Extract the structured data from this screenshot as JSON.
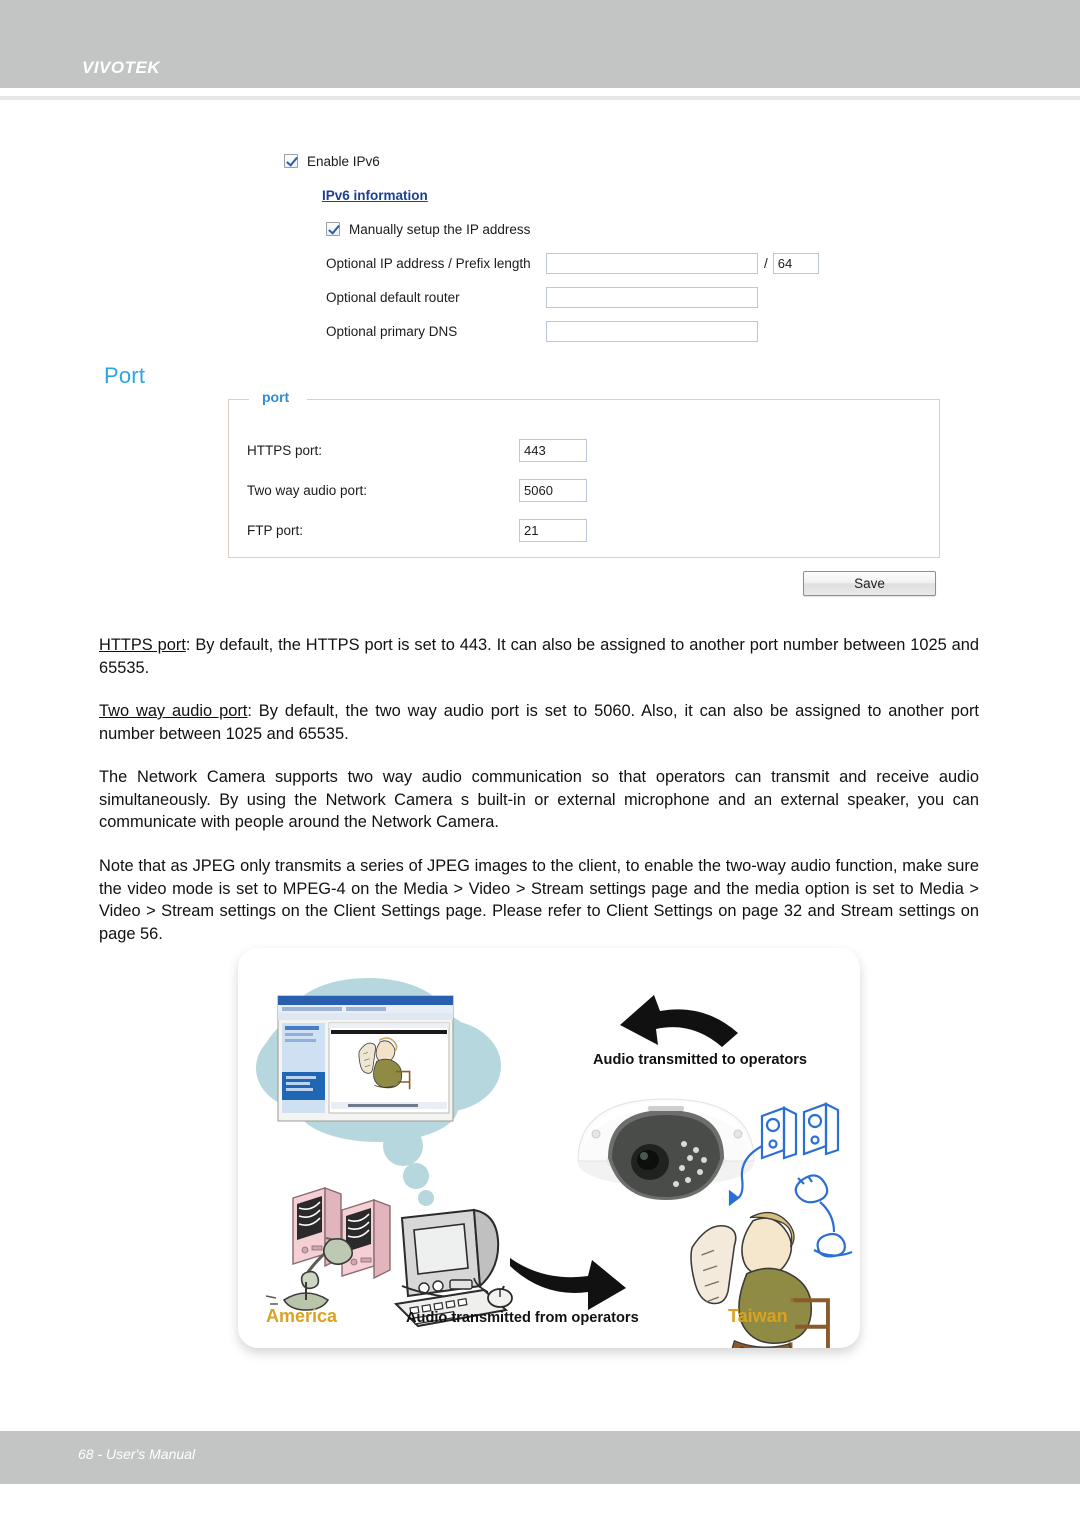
{
  "header": {
    "brand": "VIVOTEK"
  },
  "ipv6": {
    "enable_label": "Enable IPv6",
    "enable_checked": true,
    "info_link": "IPv6 information",
    "manual_label": "Manually setup the IP address",
    "manual_checked": true,
    "fields": [
      {
        "label": "Optional IP address / Prefix length",
        "value": "",
        "has_prefix": true,
        "prefix_value": "64",
        "separator": "/"
      },
      {
        "label": "Optional default router",
        "value": ""
      },
      {
        "label": "Optional primary DNS",
        "value": ""
      }
    ]
  },
  "port_section": {
    "heading": "Port",
    "legend": "port",
    "rows": [
      {
        "label": "HTTPS port:",
        "value": "443"
      },
      {
        "label": "Two way audio port:",
        "value": "5060"
      },
      {
        "label": "FTP port:",
        "value": "21"
      }
    ],
    "save_label": "Save"
  },
  "body": {
    "p1_term": "HTTPS port",
    "p1_text": ": By default, the HTTPS port is set to 443. It can also be assigned to another port number between 1025 and 65535.",
    "p2_term": "Two way audio port",
    "p2_text": ": By default, the two way audio port is set to 5060. Also, it can also be assigned to another port number between 1025 and 65535.",
    "p3": "The Network Camera supports two way audio communication so that operators can transmit and receive audio simultaneously. By using the Network Camera s built-in or external microphone and an external speaker, you can communicate with people around the Network Camera.",
    "p4": "Note that as JPEG only transmits a series of JPEG images to the client, to enable the two-way audio function, make sure the video mode is set to  MPEG-4  on the Media > Video > Stream settings page and the media option is set to  Media > Video > Stream settings  on the Client Settings page. Please refer to Client Settings on page 32 and Stream settings on page 56."
  },
  "diagram": {
    "label_to_operators": "Audio transmitted to operators",
    "label_from_operators": "Audio transmitted from operators",
    "label_left_region": "America",
    "label_right_region": "Taiwan",
    "colors": {
      "region_label": "#d9a321",
      "thought_cloud": "#b6d7dd",
      "speaker_icon": "#2b6fd4",
      "arrow": "#111111"
    }
  },
  "footer": {
    "text": "68 - User's Manual"
  }
}
